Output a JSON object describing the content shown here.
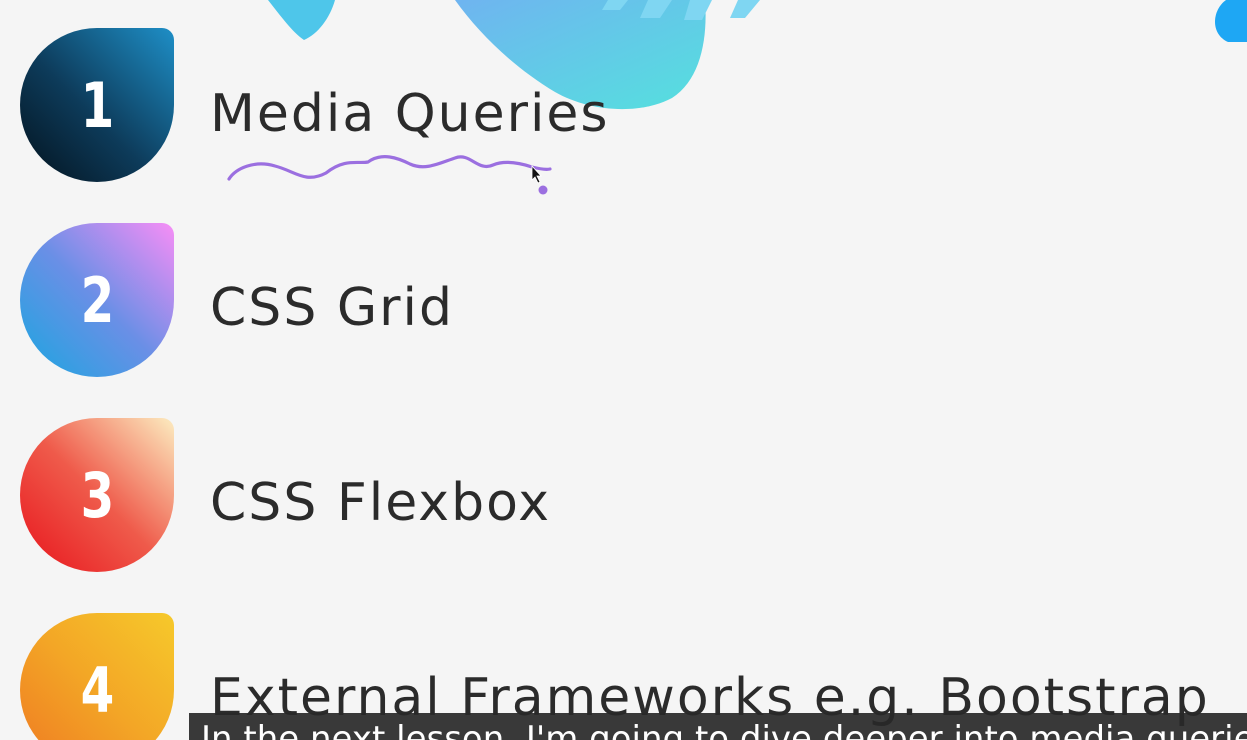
{
  "items": [
    {
      "number": "1",
      "label": "Media Queries"
    },
    {
      "number": "2",
      "label": "CSS Grid"
    },
    {
      "number": "3",
      "label": "CSS Flexbox"
    },
    {
      "number": "4",
      "label": "External Frameworks e.g. Bootstrap"
    }
  ],
  "subtitle": "In the next lesson, I'm going to dive deeper into media queries",
  "colors": {
    "background": "#f5f5f5",
    "text": "#2b2b2b",
    "annotation": "#9b6fe0",
    "blob": "#5dd4e6",
    "accent_blue": "#1ea7f4"
  }
}
